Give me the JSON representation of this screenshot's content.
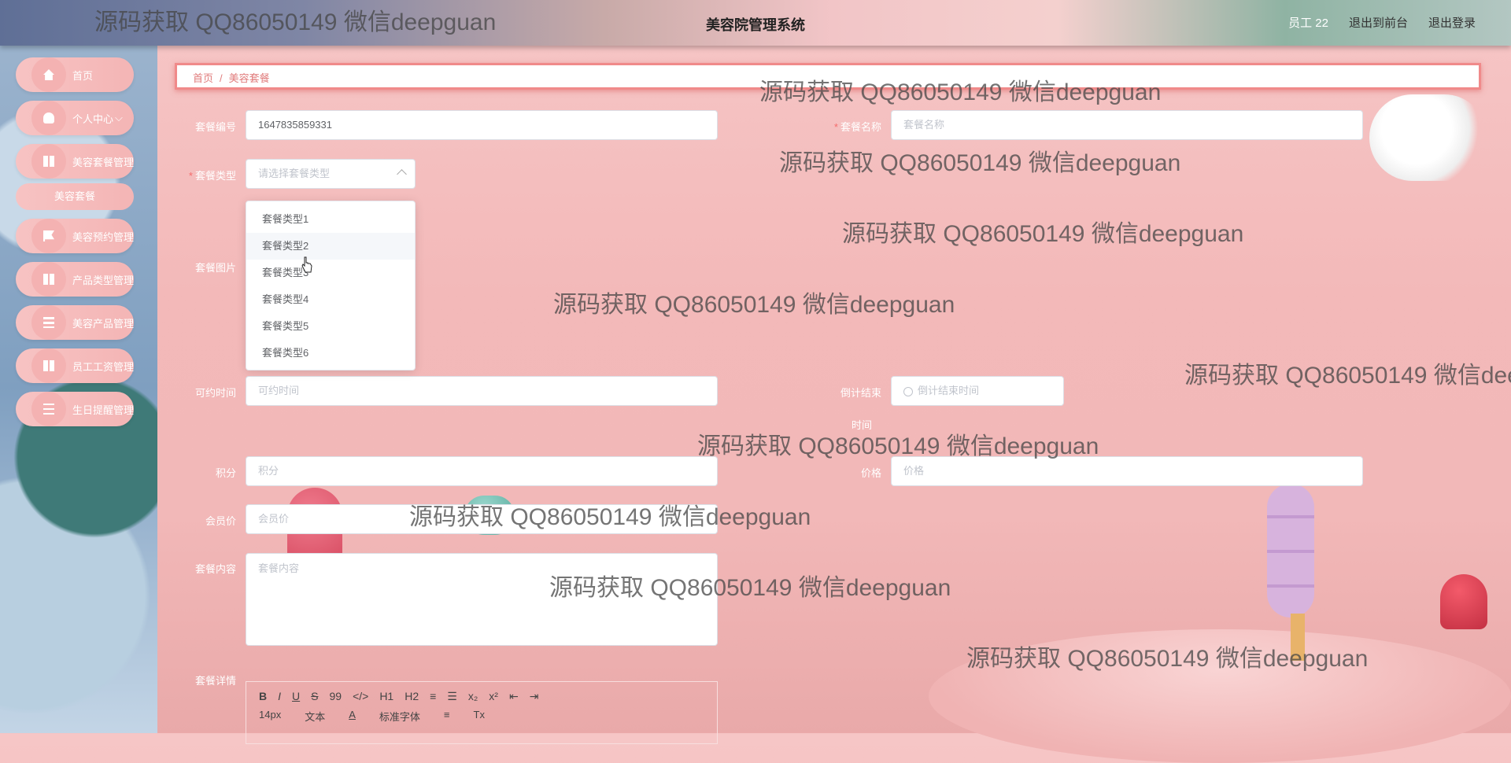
{
  "header": {
    "title": "美容院管理系统",
    "user": "员工 22",
    "back_to_front": "退出到前台",
    "logout": "退出登录"
  },
  "sidebar": {
    "items": [
      {
        "label": "首页",
        "icon": "home-icon"
      },
      {
        "label": "个人中心",
        "icon": "user-icon"
      },
      {
        "label": "美容套餐管理",
        "icon": "grid-icon"
      },
      {
        "label": "美容预约管理",
        "icon": "flag-icon"
      },
      {
        "label": "产品类型管理",
        "icon": "grid-icon"
      },
      {
        "label": "美容产品管理",
        "icon": "list-icon"
      },
      {
        "label": "员工工资管理",
        "icon": "grid-icon"
      },
      {
        "label": "生日提醒管理",
        "icon": "sliders-icon"
      }
    ],
    "sub_item": "美容套餐",
    "personal_chevron": "⌵"
  },
  "breadcrumb": {
    "home": "首页",
    "sep": "/",
    "current": "美容套餐"
  },
  "form": {
    "code_label": "套餐编号",
    "code_value": "1647835859331",
    "name_label": "套餐名称",
    "name_placeholder": "套餐名称",
    "type_label": "套餐类型",
    "type_placeholder": "请选择套餐类型",
    "image_label": "套餐图片",
    "time_label": "可约时间",
    "time_placeholder": "可约时间",
    "countdown_label": "倒计结束",
    "countdown_label2": "时间",
    "countdown_placeholder": "倒计结束时间",
    "points_label": "积分",
    "points_placeholder": "积分",
    "price_label": "价格",
    "price_placeholder": "价格",
    "member_price_label": "会员价",
    "member_price_placeholder": "会员价",
    "content_label": "套餐内容",
    "content_placeholder": "套餐内容",
    "detail_label": "套餐详情",
    "required_mark": "*"
  },
  "dropdown": {
    "options": [
      "套餐类型1",
      "套餐类型2",
      "套餐类型3",
      "套餐类型4",
      "套餐类型5",
      "套餐类型6"
    ],
    "hovered_index": 1
  },
  "editor": {
    "row1": [
      "B",
      "I",
      "U",
      "S",
      "99",
      "</>",
      "H1",
      "H2",
      "≡",
      "☰",
      "x₂",
      "x²",
      "⇤",
      "⇥"
    ],
    "size": "14px",
    "text": "文本",
    "font": "标准字体",
    "color_a": "A",
    "align": "≡",
    "clear": "Tx"
  },
  "watermark": "源码获取 QQ86050149 微信deepguan"
}
